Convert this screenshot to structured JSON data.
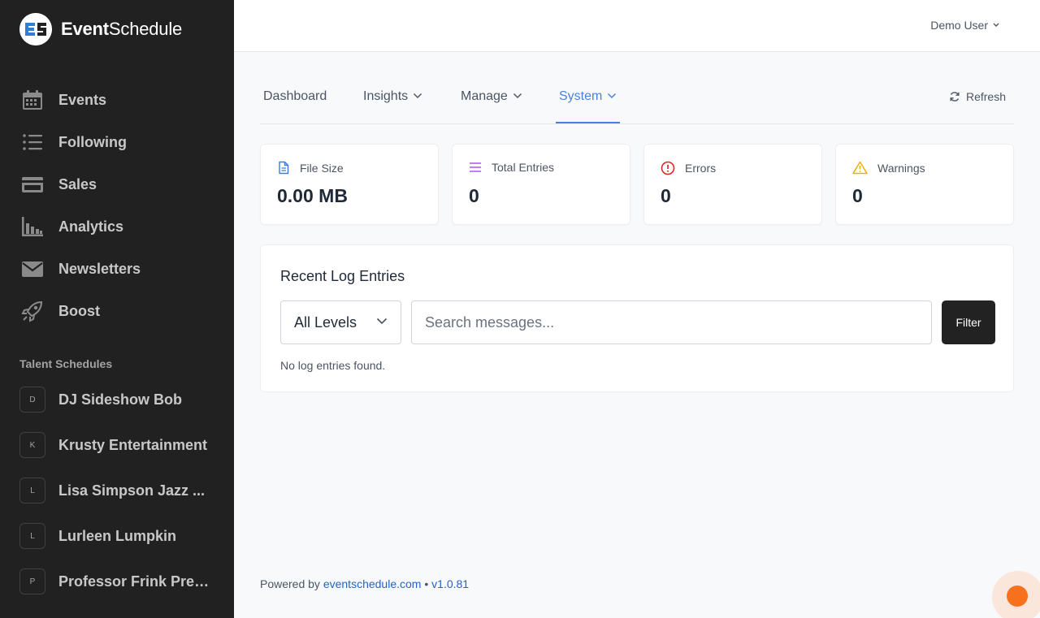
{
  "app": {
    "logo_bold": "Event",
    "logo_rest": "Schedule",
    "logo_icon": "event-schedule-logo"
  },
  "sidebar": {
    "nav": [
      {
        "label": "Events",
        "icon": "calendar-icon"
      },
      {
        "label": "Following",
        "icon": "list-icon"
      },
      {
        "label": "Sales",
        "icon": "credit-card-icon"
      },
      {
        "label": "Analytics",
        "icon": "bar-chart-icon"
      },
      {
        "label": "Newsletters",
        "icon": "envelope-icon"
      },
      {
        "label": "Boost",
        "icon": "rocket-icon"
      }
    ],
    "section_title": "Talent Schedules",
    "talent": [
      {
        "initial": "D",
        "name": "DJ Sideshow Bob"
      },
      {
        "initial": "K",
        "name": "Krusty Entertainment"
      },
      {
        "initial": "L",
        "name": "Lisa Simpson Jazz ..."
      },
      {
        "initial": "L",
        "name": "Lurleen Lumpkin"
      },
      {
        "initial": "P",
        "name": "Professor Frink Pres..."
      }
    ]
  },
  "header": {
    "user": "Demo User"
  },
  "tabs": {
    "items": [
      {
        "label": "Dashboard"
      },
      {
        "label": "Insights"
      },
      {
        "label": "Manage"
      },
      {
        "label": "System"
      }
    ],
    "active": "System",
    "refresh_label": "Refresh"
  },
  "stats": [
    {
      "label": "File Size",
      "value": "0.00 MB",
      "icon": "document-icon",
      "color": "#3b7be0"
    },
    {
      "label": "Total Entries",
      "value": "0",
      "icon": "list-lines-icon",
      "color": "#a855f7"
    },
    {
      "label": "Errors",
      "value": "0",
      "icon": "alert-circle-icon",
      "color": "#dc2626"
    },
    {
      "label": "Warnings",
      "value": "0",
      "icon": "warning-triangle-icon",
      "color": "#eab308"
    }
  ],
  "logs": {
    "title": "Recent Log Entries",
    "level_selected": "All Levels",
    "search_placeholder": "Search messages...",
    "search_value": "",
    "filter_label": "Filter",
    "empty_message": "No log entries found."
  },
  "footer": {
    "prefix": "Powered by",
    "link": "eventschedule.com",
    "separator": "•",
    "version": "v1.0.81"
  },
  "colors": {
    "sidebar_bg": "#212121",
    "accent": "#4a7fe0",
    "fab": "#f7701c"
  }
}
